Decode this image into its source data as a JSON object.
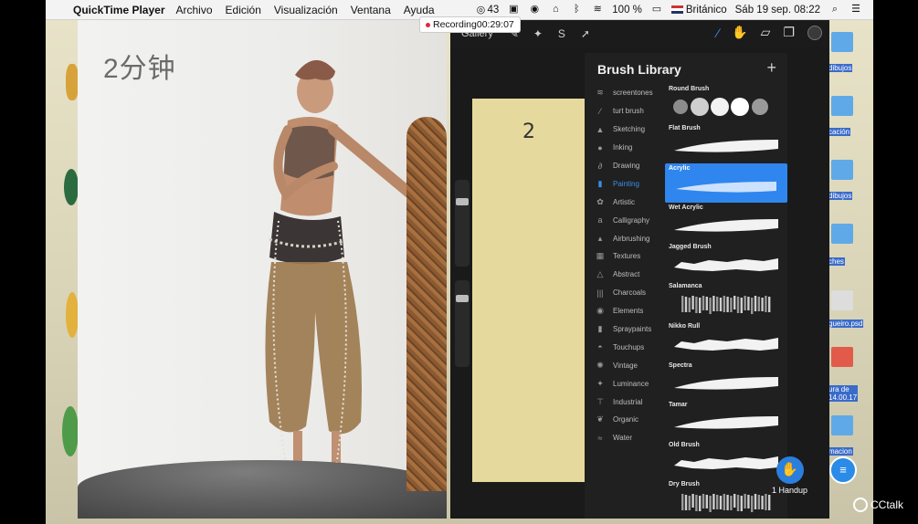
{
  "menubar": {
    "app_name": "QuickTime Player",
    "menus": [
      "Archivo",
      "Edición",
      "Visualización",
      "Ventana",
      "Ayuda"
    ],
    "status": {
      "notifications": "43",
      "battery": "100 %",
      "keyboard": "Británico",
      "datetime": "Sáb 19 sep.  08:22"
    }
  },
  "recording": {
    "label": "Recording",
    "time": "00:29:07"
  },
  "video": {
    "timer_text": "2分钟"
  },
  "procreate": {
    "gallery_label": "Gallery",
    "canvas_mark": "2",
    "brush_library": {
      "title": "Brush Library",
      "add_label": "+",
      "categories": [
        {
          "label": "screentones",
          "icon": "≋"
        },
        {
          "label": "turt brush",
          "icon": "⁄"
        },
        {
          "label": "Sketching",
          "icon": "▲"
        },
        {
          "label": "Inking",
          "icon": "●"
        },
        {
          "label": "Drawing",
          "icon": "∂"
        },
        {
          "label": "Painting",
          "icon": "▮",
          "active": true
        },
        {
          "label": "Artistic",
          "icon": "✿"
        },
        {
          "label": "Calligraphy",
          "icon": "a"
        },
        {
          "label": "Airbrushing",
          "icon": "▴"
        },
        {
          "label": "Textures",
          "icon": "▦"
        },
        {
          "label": "Abstract",
          "icon": "△"
        },
        {
          "label": "Charcoals",
          "icon": "|||"
        },
        {
          "label": "Elements",
          "icon": "◉"
        },
        {
          "label": "Spraypaints",
          "icon": "▮"
        },
        {
          "label": "Touchups",
          "icon": "◓"
        },
        {
          "label": "Vintage",
          "icon": "✺"
        },
        {
          "label": "Luminance",
          "icon": "✦"
        },
        {
          "label": "Industrial",
          "icon": "⊤"
        },
        {
          "label": "Organic",
          "icon": "❦"
        },
        {
          "label": "Water",
          "icon": "≈"
        }
      ],
      "brushes": [
        {
          "name": "Round Brush",
          "kind": "dots"
        },
        {
          "name": "Flat Brush",
          "kind": "taper"
        },
        {
          "name": "Acrylic",
          "kind": "soft",
          "active": true
        },
        {
          "name": "Wet Acrylic",
          "kind": "taper"
        },
        {
          "name": "Jagged Brush",
          "kind": "rough"
        },
        {
          "name": "Salamanca",
          "kind": "texture"
        },
        {
          "name": "Nikko Rull",
          "kind": "rough"
        },
        {
          "name": "Spectra",
          "kind": "taper"
        },
        {
          "name": "Tamar",
          "kind": "taper"
        },
        {
          "name": "Old Brush",
          "kind": "rough"
        },
        {
          "name": "Dry Brush",
          "kind": "texture"
        }
      ]
    }
  },
  "handup": {
    "count_label": "1 Handup"
  },
  "brand": {
    "label": "CCtalk"
  },
  "desktop_labels": [
    "dibujos",
    "cación",
    "dibujos",
    "ches",
    "gueiro.psd",
    "ura de\n14.00.17",
    "macion"
  ],
  "colors": {
    "accent": "#2f86ee",
    "canvas": "#e5d99d"
  }
}
